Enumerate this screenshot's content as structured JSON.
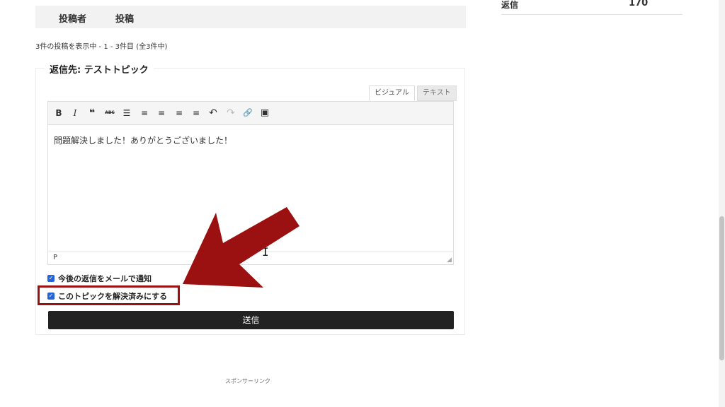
{
  "topics_table": {
    "col_author": "投稿者",
    "col_posts": "投稿"
  },
  "pagination_text": "3件の投稿を表示中 - 1 - 3件目 (全3件中)",
  "reply_form": {
    "legend": "返信先: テストトピック",
    "tab_visual": "ビジュアル",
    "tab_text": "テキスト",
    "toolbar": {
      "bold": "B",
      "italic": "I",
      "quote": "❝",
      "strike": "ABC",
      "bullet_list": "☰",
      "number_list": "≡",
      "align_left": "≡",
      "align_center": "≡",
      "align_right": "≡",
      "undo": "↶",
      "redo": "↷",
      "link": "🔗",
      "image": "▣"
    },
    "content": "問題解決しました！ありがとうございました！",
    "status_path": "P",
    "notify_label": "今後の返信をメールで通知",
    "resolved_label": "このトピックを解決済みにする",
    "submit_label": "送信"
  },
  "sponsor_text": "スポンサーリンク",
  "sidebar": {
    "replies_label": "返信",
    "replies_value": "170"
  },
  "colors": {
    "annotation": "#9b1111",
    "checkbox": "#2563d8",
    "button": "#222222"
  }
}
